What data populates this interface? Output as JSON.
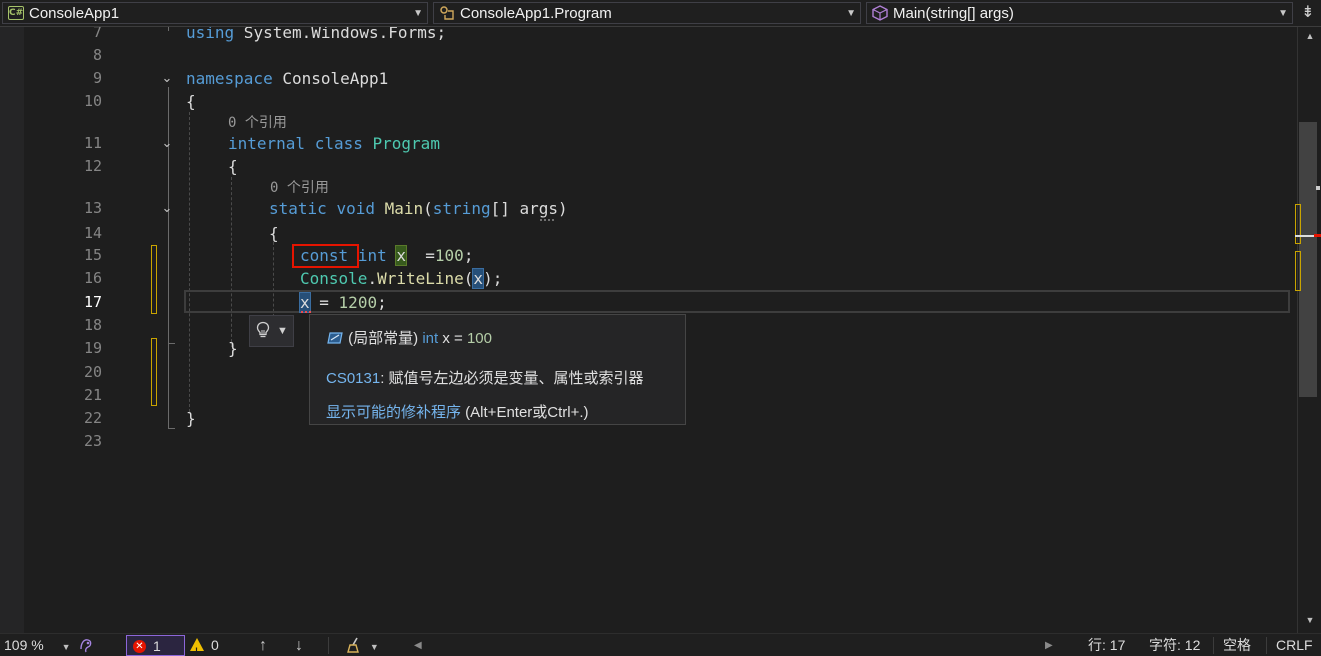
{
  "navbar": {
    "project": "ConsoleApp1",
    "project_icon": "csharp-project-icon",
    "type": "ConsoleApp1.Program",
    "type_icon": "class-icon",
    "member": "Main(string[] args)",
    "member_icon": "method-icon"
  },
  "lines": {
    "l7": "7",
    "l8": "8",
    "l9": "9",
    "l10": "10",
    "l11": "11",
    "l12": "12",
    "l13": "13",
    "l14": "14",
    "l15": "15",
    "l16": "16",
    "l17": "17",
    "l18": "18",
    "l19": "19",
    "l20": "20",
    "l21": "21",
    "l22": "22",
    "l23": "23"
  },
  "code": {
    "using_kw": "using",
    "using_ns": " System.Windows.Forms;",
    "namespace_kw": "namespace",
    "namespace_name": " ConsoleApp1",
    "open_brace": "{",
    "close_brace": "}",
    "refs_class": "0 个引用",
    "internal_kw": "internal",
    "class_kw": "class",
    "class_name": "Program",
    "refs_method": "0 个引用",
    "static_kw": "static",
    "void_kw": "void",
    "main_name": "Main",
    "paren_open": "(",
    "string_kw": "string",
    "array_brackets": "[] ",
    "args_name": "args",
    "paren_close": ")",
    "const_kw": "const",
    "int_kw": "int",
    "var_x": "x",
    "assign_100": "  =",
    "num_100": "100",
    "semicolon": ";",
    "console_type": "Console",
    "dot": ".",
    "writeline": "WriteLine",
    "close_call": ");",
    "assign_1200": " = ",
    "num_1200": "1200"
  },
  "tooltip": {
    "icon": "local-constant-icon",
    "prefix": " (局部常量) ",
    "int_kw": "int",
    "decl": " x = ",
    "value": "100",
    "error_code": "CS0131",
    "error_message": ": 赋值号左边必须是变量、属性或索引器",
    "fix_link": "显示可能的修补程序",
    "fix_shortcut": " (Alt+Enter或Ctrl+.)"
  },
  "status": {
    "zoom": "109 %",
    "error_count": "1",
    "warning_count": "0",
    "line": "行: 17",
    "column": "字符: 12",
    "indent": "空格",
    "line_ending": "CRLF"
  },
  "colors": {
    "keyword": "#569cd6",
    "type": "#4ec9b0",
    "method": "#dcdcaa",
    "number": "#b5cea8",
    "error": "#e51400",
    "change_bar": "#c9a400"
  }
}
